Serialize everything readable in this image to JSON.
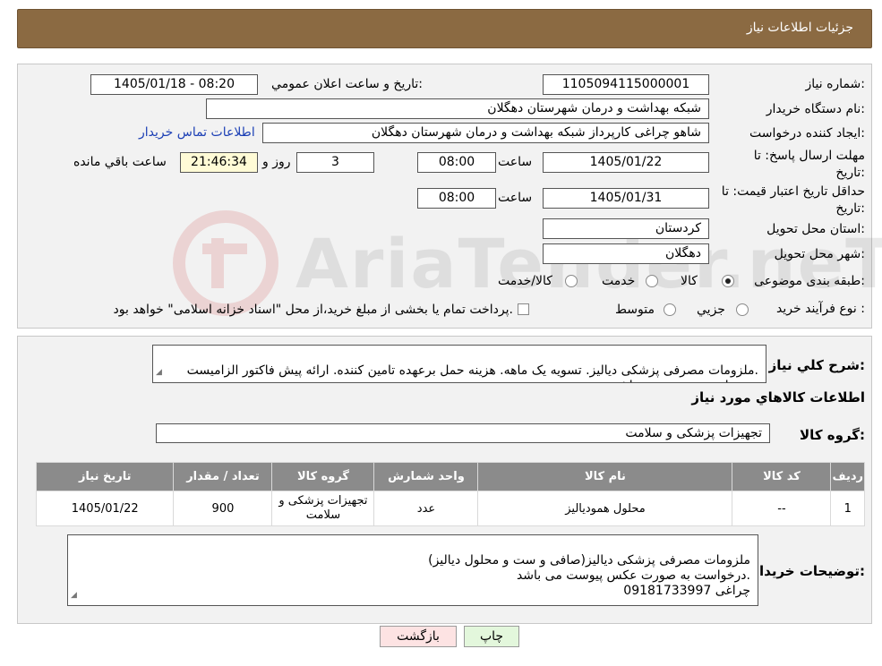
{
  "header": {
    "title": "جزئیات اطلاعات نیاز"
  },
  "labels": {
    "need_number": "شماره نیاز:",
    "announce_datetime": "تاریخ و ساعت اعلان عمومي:",
    "buyer_org": "نام دستگاه خریدار:",
    "requester": "ایجاد کننده درخواست:",
    "reply_deadline": "مهلت ارسال پاسخ: تا تاریخ:",
    "price_validity": "حداقل تاریخ اعتبار قیمت: تا تاریخ:",
    "delivery_province": "استان محل تحویل:",
    "delivery_city": "شهر محل تحویل:",
    "category": "طبقه بندی موضوعی:",
    "purchase_type": "نوع فرآیند خرید :",
    "time": "ساعت",
    "day_and": "روز و",
    "remaining": "ساعت باقي مانده",
    "description": "شرح کلي نیاز:",
    "goods_info": "اطلاعات کالاهاي مورد نیاز",
    "goods_group": "گروه کالا:",
    "buyer_notes": "توضیحات خریدار:"
  },
  "values": {
    "need_number": "1105094115000001",
    "announce_datetime": "1405/01/18 - 08:20",
    "buyer_org": "شبکه بهداشت و درمان شهرستان دهگلان",
    "requester": "شاهو چراغی کارپرداز شبکه بهداشت و درمان شهرستان دهگلان",
    "contact_link": "اطلاعات تماس خریدار",
    "reply_date": "1405/01/22",
    "reply_time": "08:00",
    "reply_days": "3",
    "reply_remaining": "21:46:34",
    "validity_date": "1405/01/31",
    "validity_time": "08:00",
    "province": "کردستان",
    "city": "دهگلان"
  },
  "category_options": [
    {
      "label": "کالا",
      "selected": true
    },
    {
      "label": "خدمت",
      "selected": false
    },
    {
      "label": "کالا/خدمت",
      "selected": false
    }
  ],
  "purchase_options": [
    {
      "label": "جزيي",
      "selected": false
    },
    {
      "label": "متوسط",
      "selected": false
    }
  ],
  "purchase_note": "پرداخت تمام یا بخشی از مبلغ خرید،از محل \"اسناد خزانه اسلامی\" خواهد بود.",
  "description_text": "ملزومات مصرفی پزشکی دیالیز. تسویه یک ماهه. هزینه حمل برعهده تامین کننده. ارائه پیش فاکتور الزامیست.\nدرخواست پیوست می باشد.",
  "goods_group_value": "تجهیزات پزشکی و سلامت",
  "table": {
    "headers": [
      "ردیف",
      "کد کالا",
      "نام کالا",
      "واحد شمارش",
      "گروه کالا",
      "تعداد / مقدار",
      "تاریخ نیاز"
    ],
    "rows": [
      [
        "1",
        "--",
        "محلول همودیالیز",
        "عدد",
        "تجهیزات پزشکی و سلامت",
        "900",
        "1405/01/22"
      ]
    ]
  },
  "buyer_notes_text": "ملزومات مصرفی پزشکی دیالیز(صافی و ست و محلول دیالیز)\nدرخواست به صورت عکس پیوست می باشد.\nچراغی 09181733997",
  "buttons": {
    "print": "چاپ",
    "back": "بازگشت"
  },
  "colors": {
    "header_bg": "#8b6a42",
    "table_header_bg": "#8b8b8b",
    "back_button_bg": "#fde3e3",
    "print_button_bg": "#e3f7dc",
    "link": "#1b3fb5"
  },
  "watermark": "AriaTender.neT"
}
